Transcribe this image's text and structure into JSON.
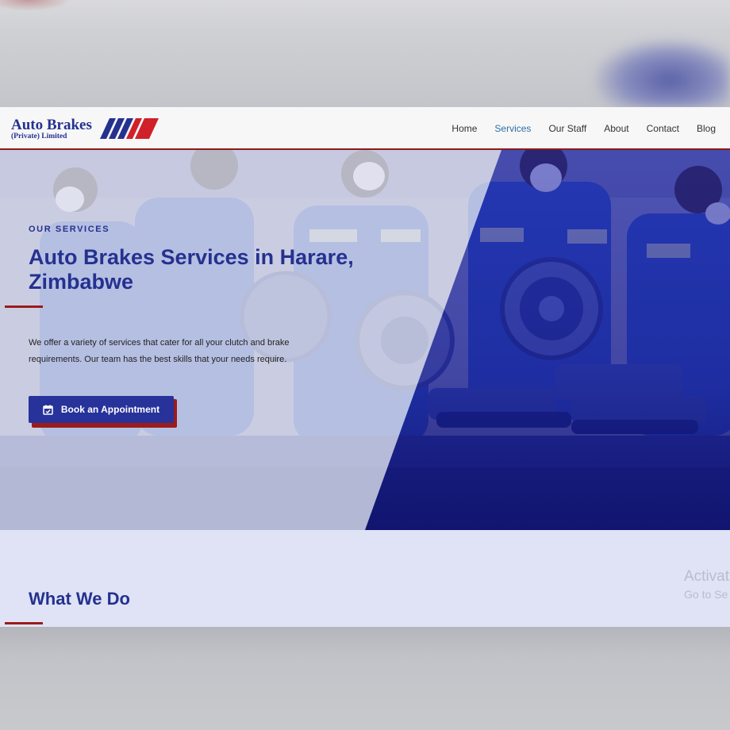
{
  "header": {
    "logo_title": "Auto Brakes",
    "logo_subtitle": "(Private) Limited",
    "nav": [
      {
        "label": "Home",
        "active": false
      },
      {
        "label": "Services",
        "active": true
      },
      {
        "label": "Our Staff",
        "active": false
      },
      {
        "label": "About",
        "active": false
      },
      {
        "label": "Contact",
        "active": false
      },
      {
        "label": "Blog",
        "active": false
      }
    ]
  },
  "hero": {
    "eyebrow": "OUR SERVICES",
    "title": "Auto Brakes Services in Harare, Zimbabwe",
    "description": "We offer a variety of services that cater for all your clutch and brake requirements. Our team has the best skills that your needs require.",
    "cta_label": "Book an Appointment",
    "cta_icon": "calendar-check-icon"
  },
  "section": {
    "title": "What We Do"
  },
  "watermark": {
    "line1": "Activat",
    "line2": "Go to Se"
  },
  "colors": {
    "brand_blue": "#25318f",
    "accent_red": "#9a1c1c",
    "nav_active": "#2b6fa6"
  }
}
